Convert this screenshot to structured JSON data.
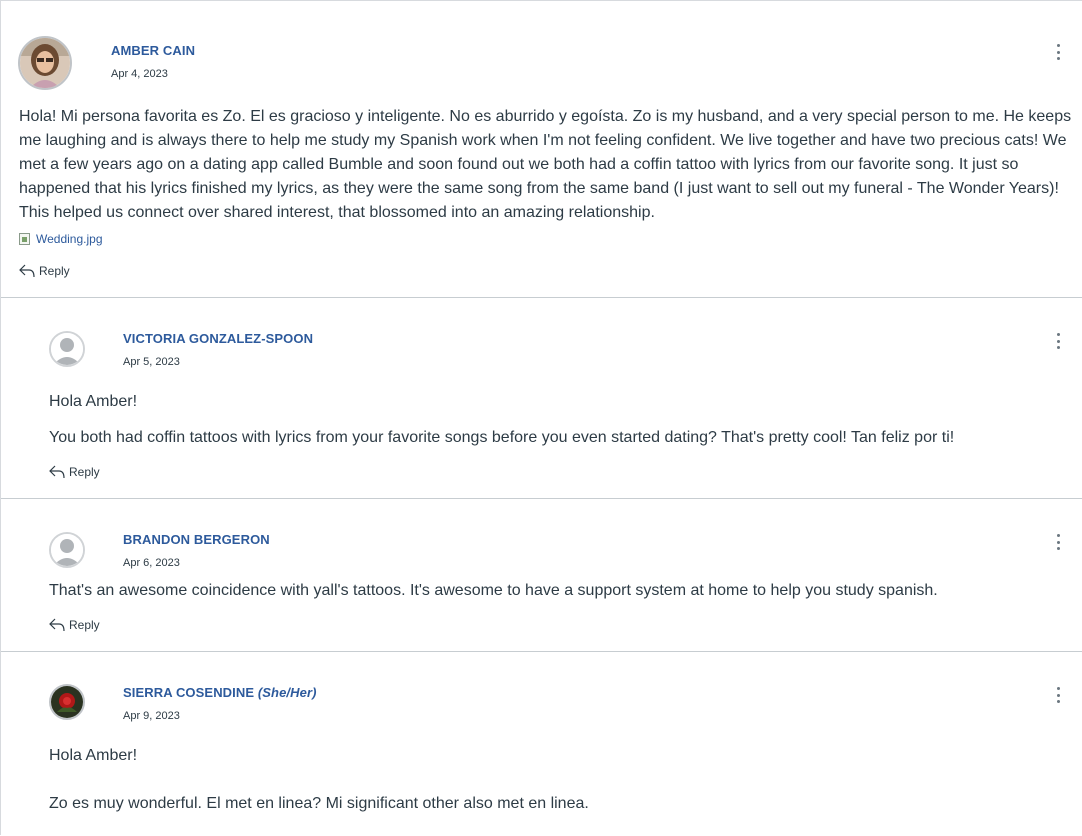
{
  "entries": [
    {
      "author": "AMBER CAIN",
      "pronouns": "",
      "date": "Apr 4, 2023",
      "paragraphs": [
        "Hola! Mi persona favorita es Zo. El es gracioso y inteligente. No es aburrido y egoísta. Zo is my husband, and a very special person to me. He keeps me laughing and is always there to help me study my Spanish work when I'm not feeling confident. We live together and have two precious cats! We met a few years ago on a dating app called Bumble and soon found out we both had a coffin tattoo with lyrics from our favorite song. It just so happened that his lyrics finished my lyrics, as they were the same song from the same band (I just want to sell out my funeral - The Wonder Years)! This helped us connect over shared interest, that blossomed into an amazing relationship."
      ],
      "attachment": "Wedding.jpg",
      "reply_label": "Reply",
      "avatar": "photo-woman"
    },
    {
      "author": "VICTORIA GONZALEZ-SPOON",
      "pronouns": "",
      "date": "Apr 5, 2023",
      "paragraphs": [
        "Hola Amber!",
        "You both had coffin tattoos with lyrics from your favorite songs before you even started dating? That's pretty cool! Tan feliz por ti!"
      ],
      "reply_label": "Reply",
      "avatar": "default-user"
    },
    {
      "author": "BRANDON BERGERON",
      "pronouns": "",
      "date": "Apr 6, 2023",
      "paragraphs": [
        "That's an awesome coincidence with yall's tattoos. It's awesome to have a support system at home to help you study spanish."
      ],
      "reply_label": "Reply",
      "avatar": "default-user"
    },
    {
      "author": "SIERRA COSENDINE",
      "pronouns": "(She/Her)",
      "date": "Apr 9, 2023",
      "paragraphs": [
        "Hola Amber!",
        "Zo es muy wonderful. El met en linea? Mi significant other also met en linea."
      ],
      "avatar": "photo-rose"
    }
  ],
  "icons": {
    "options": "kebab-icon",
    "reply": "reply-arrow-icon",
    "file": "image-file-icon"
  },
  "colors": {
    "author_link": "#2d5a9c",
    "text": "#2d3b45",
    "divider": "#c7cdd1"
  }
}
